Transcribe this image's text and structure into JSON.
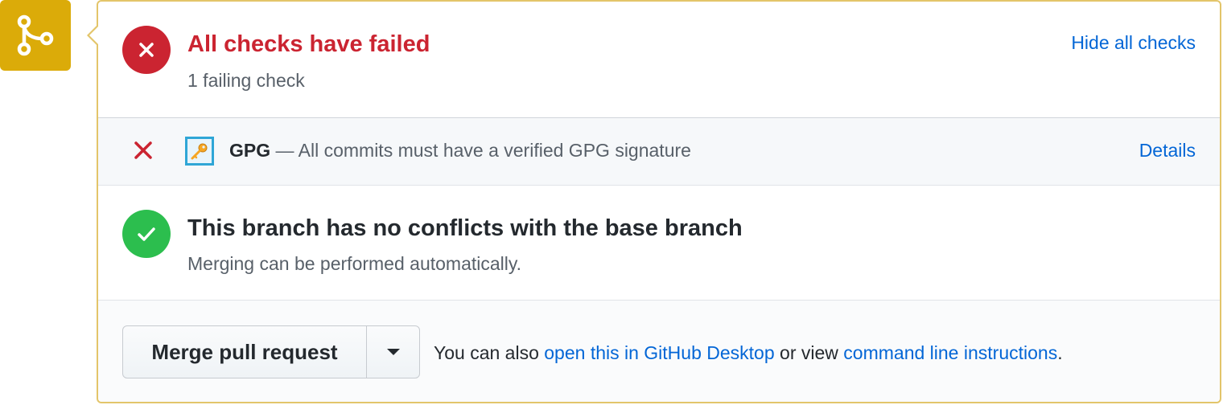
{
  "colors": {
    "branch_badge": "#dbab09",
    "fail_red": "#cb2431",
    "success_green": "#2cbe4e",
    "link_blue": "#0366d6"
  },
  "icons": {
    "branch": "git-merge-icon",
    "fail": "x-icon",
    "success": "check-icon",
    "app": "key-icon",
    "dropdown": "triangle-down-icon"
  },
  "checks_status": {
    "title": "All checks have failed",
    "subtitle": "1 failing check",
    "toggle_link": "Hide all checks"
  },
  "check_item": {
    "name": "GPG",
    "separator": " — ",
    "description": "All commits must have a verified GPG signature",
    "details_link": "Details"
  },
  "conflict_status": {
    "title": "This branch has no conflicts with the base branch",
    "subtitle": "Merging can be performed automatically."
  },
  "merge": {
    "button_label": "Merge pull request",
    "text_prefix": "You can also ",
    "desktop_link": "open this in GitHub Desktop",
    "text_middle": " or view ",
    "cli_link": "command line instructions",
    "text_suffix": "."
  }
}
